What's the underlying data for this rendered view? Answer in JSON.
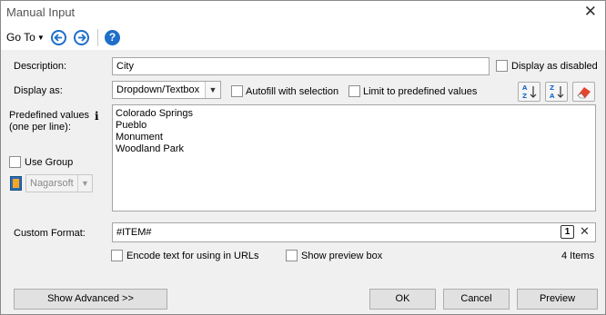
{
  "window": {
    "title": "Manual Input"
  },
  "toolbar": {
    "goto_label": "Go To",
    "help_label": "?"
  },
  "form": {
    "description_label": "Description:",
    "description_value": "City",
    "display_disabled_label": "Display as disabled",
    "display_as_label": "Display as:",
    "display_as_value": "Dropdown/Textbox",
    "autofill_label": "Autofill with selection",
    "limit_label": "Limit to predefined values",
    "predefined_label_line1": "Predefined values",
    "predefined_label_line2": "(one per line):",
    "predefined_values": [
      "Colorado Springs",
      "Pueblo",
      "Monument",
      "Woodland Park"
    ],
    "use_group_label": "Use Group",
    "group_value": "Nagarsoft",
    "custom_format_label": "Custom Format:",
    "custom_format_value": "#ITEM#",
    "format_badge": "1",
    "encode_label": "Encode text for using in URLs",
    "preview_box_label": "Show preview box",
    "items_count": "4 Items"
  },
  "buttons": {
    "show_advanced": "Show Advanced >>",
    "ok": "OK",
    "cancel": "Cancel",
    "preview": "Preview"
  },
  "colors": {
    "accent": "#1e6fc8",
    "eraser": "#e2462f"
  }
}
